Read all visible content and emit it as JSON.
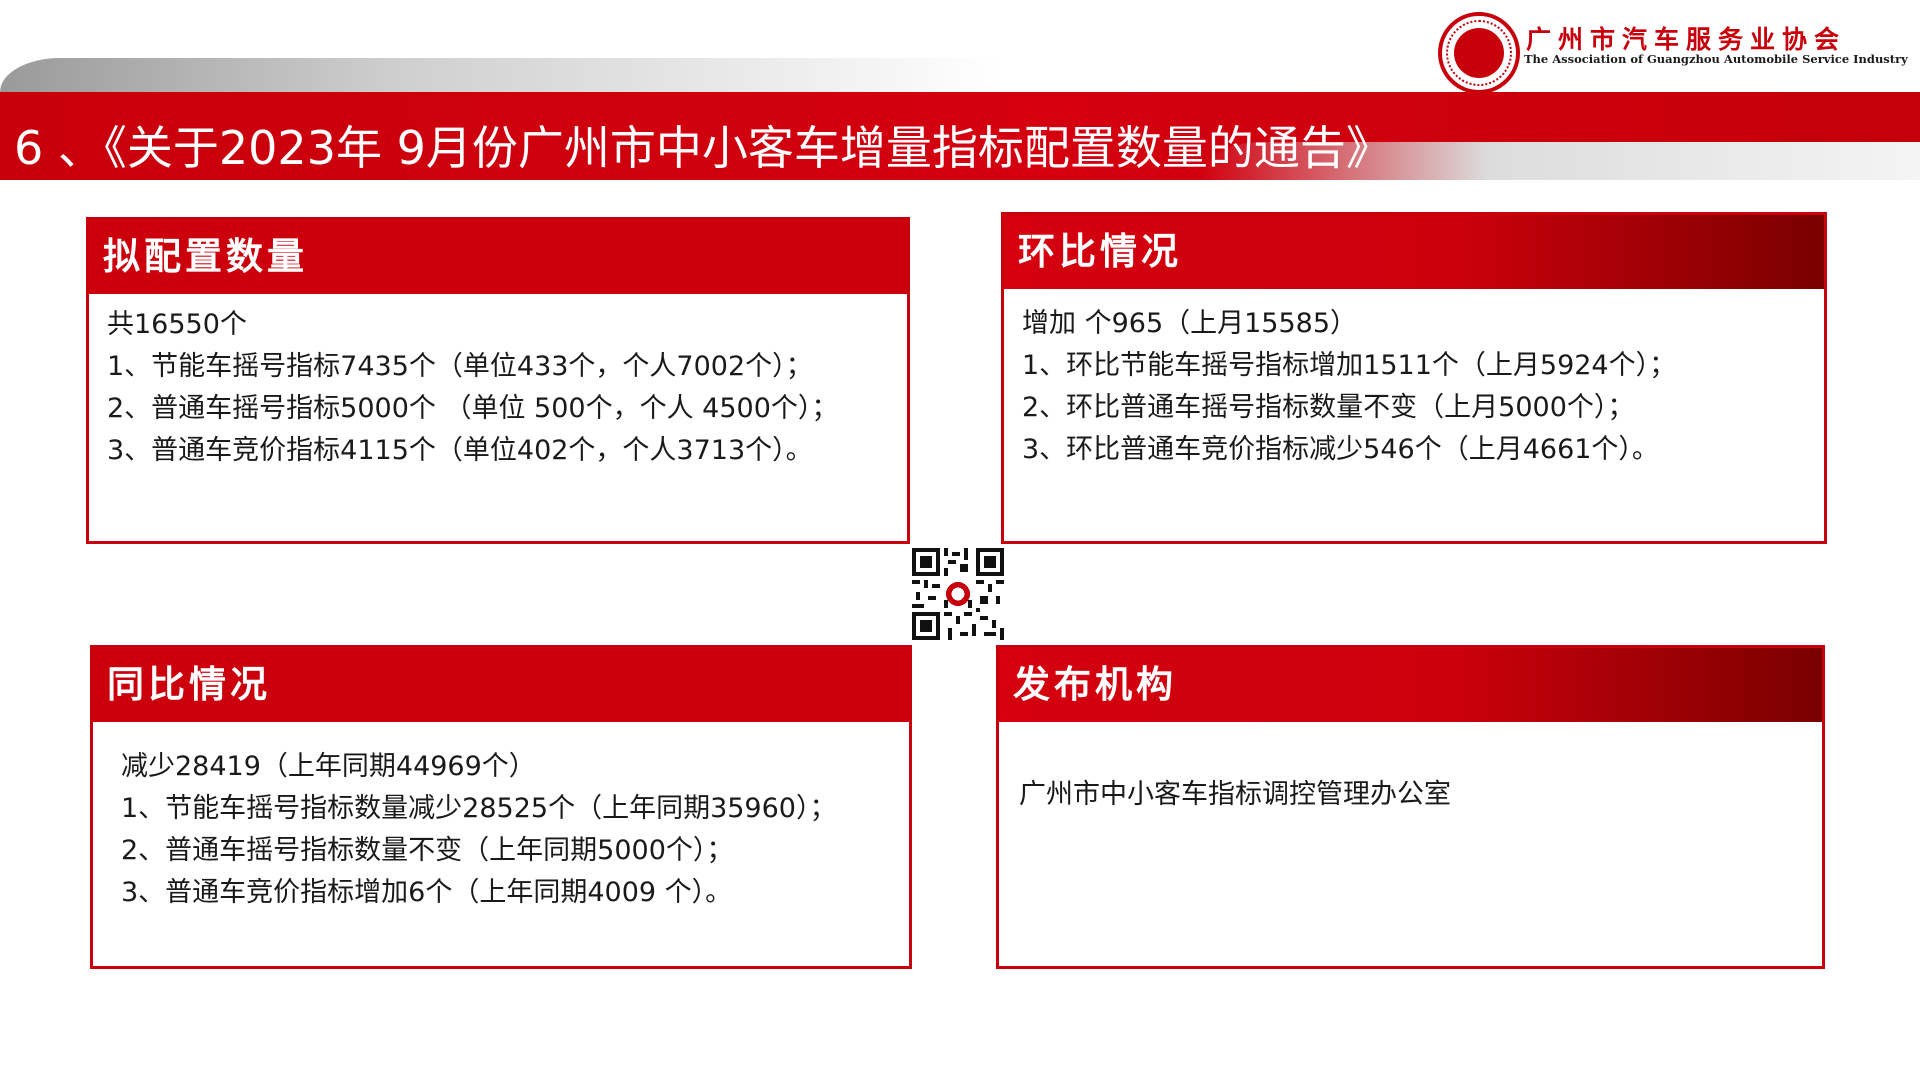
{
  "header": {
    "title": "6 、《关于2023年 9月份广州市中小客车增量指标配置数量的通告》"
  },
  "logo": {
    "name_cn": "广州市汽车服务业协会",
    "name_en": "The Association of Guangzhou Automobile Service Industry",
    "icon": "association-seal-icon"
  },
  "cards": {
    "planned": {
      "heading": "拟配置数量",
      "lines": [
        "共16550个",
        "1、节能车摇号指标7435个（单位433个，个人7002个）；",
        "2、普通车摇号指标5000个 （单位 500个，个人 4500个）；",
        "3、普通车竞价指标4115个（单位402个，个人3713个）。"
      ]
    },
    "mom": {
      "heading": "环比情况",
      "lines": [
        "增加 个965（上月15585）",
        "1、环比节能车摇号指标增加1511个（上月5924个）；",
        "2、环比普通车摇号指标数量不变（上月5000个）；",
        "3、环比普通车竞价指标减少546个（上月4661个）。"
      ]
    },
    "yoy": {
      "heading": "同比情况",
      "lines": [
        "减少28419（上年同期44969个）",
        "1、节能车摇号指标数量减少28525个（上年同期35960）；",
        "2、普通车摇号指标数量不变（上年同期5000个）；",
        "3、普通车竞价指标增加6个（上年同期4009 个）。"
      ]
    },
    "publisher": {
      "heading": "发布机构",
      "lines": [
        "广州市中小客车指标调控管理办公室"
      ]
    }
  },
  "colors": {
    "brand_red": "#c8000b",
    "dark_red": "#7a0000"
  },
  "qr": {
    "icon": "qr-code-icon"
  }
}
